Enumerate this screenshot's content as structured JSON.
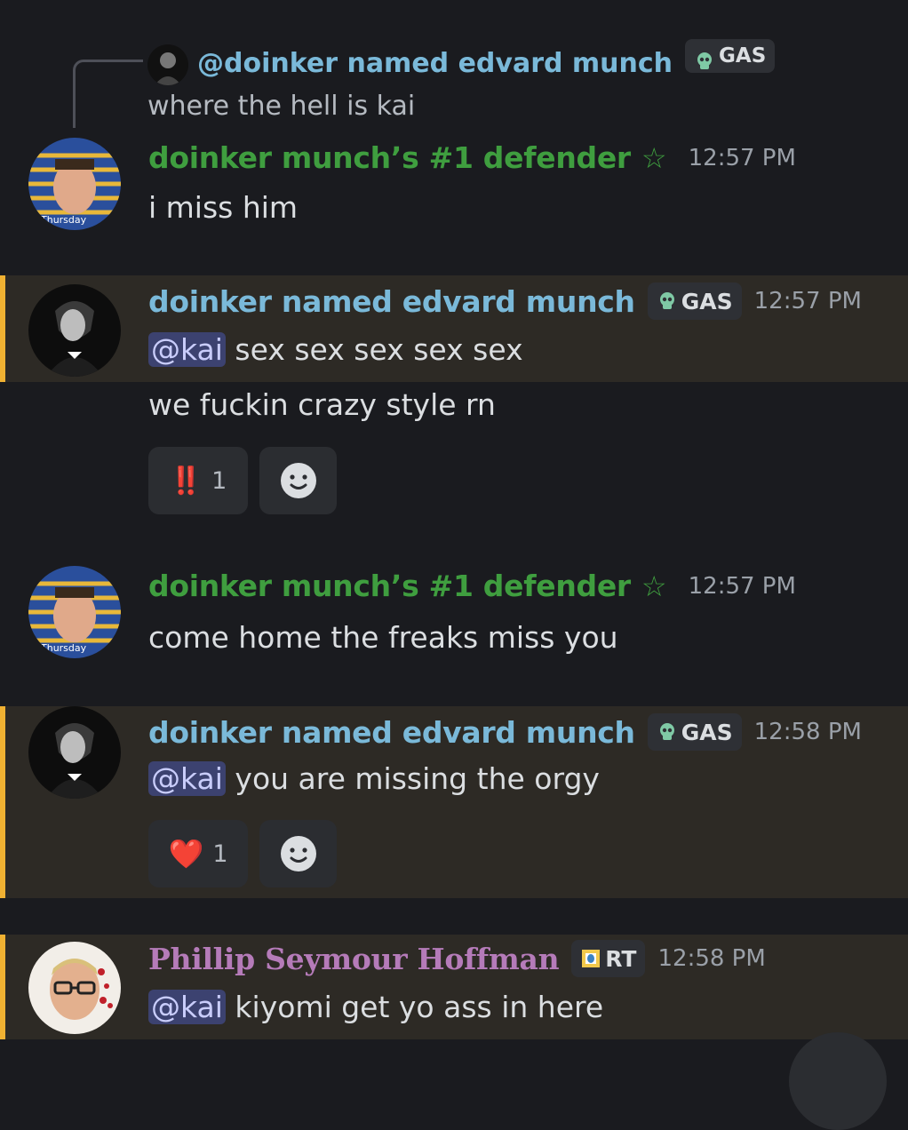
{
  "reply": {
    "name": "@doinker named edvard munch",
    "tag": "GAS",
    "text": "where the hell is kai"
  },
  "messages": [
    {
      "user": "doinker munch’s #1 defender",
      "star": "☆",
      "time": "12:57 PM",
      "lines": [
        "i miss him"
      ],
      "avatar_label": "Thursday"
    },
    {
      "user": "doinker named edvard munch",
      "tag": "GAS",
      "time": "12:57 PM",
      "mention": "@kai",
      "lines": [
        "sex sex sex sex sex",
        "we fuckin crazy style rn"
      ],
      "reaction": {
        "emoji": "‼️",
        "count": "1"
      }
    },
    {
      "user": "doinker munch’s #1 defender",
      "star": "☆",
      "time": "12:57 PM",
      "lines": [
        "come home the freaks miss you"
      ],
      "avatar_label": "Thursday"
    },
    {
      "user": "doinker named edvard munch",
      "tag": "GAS",
      "time": "12:58 PM",
      "mention": "@kai",
      "lines": [
        "you are missing the orgy"
      ],
      "reaction": {
        "emoji": "❤️",
        "count": "1"
      }
    },
    {
      "user": "Phillip Seymour Hoffman",
      "tag": "RT",
      "time": "12:58 PM",
      "mention": "@kai",
      "lines": [
        "kiyomi get yo ass in here"
      ]
    }
  ],
  "colors": {
    "background": "#1a1b1f",
    "mention_highlight": "#2d2a25",
    "mention_bar": "#f0b132",
    "green_name": "#3f9e3f",
    "blue_name": "#7ab9d9",
    "purple_name": "#b57bb9"
  }
}
